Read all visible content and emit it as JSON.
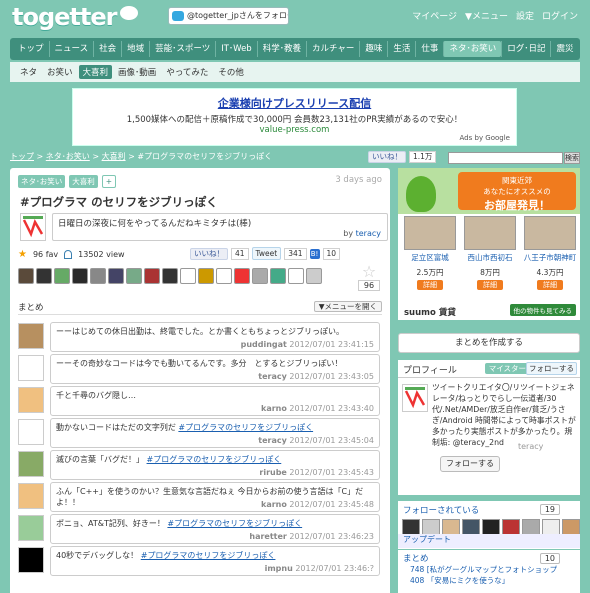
{
  "header": {
    "logo": "togetter",
    "follow_label": "@togetter_jpさんをフォロー",
    "links": [
      "マイページ",
      "▼メニュー",
      "設定",
      "ログイン"
    ]
  },
  "nav": [
    "トップ",
    "ニュース",
    "社会",
    "地域",
    "芸能･スポーツ",
    "IT･Web",
    "科学･教養",
    "カルチャー",
    "趣味",
    "生活",
    "仕事",
    "ネタ･お笑い",
    "ログ･日記",
    "震災"
  ],
  "nav_active_index": 11,
  "subnav": [
    "ネタ",
    "お笑い",
    "大喜利",
    "画像･動画",
    "やってみた",
    "その他"
  ],
  "subnav_active_index": 2,
  "ad": {
    "title": "企業様向けプレスリリース配信",
    "line": "1,500媒体への配信＋原稿作成で30,000円 会員数23,131社のPR実績があるので安心！",
    "url": "value-press.com",
    "by": "Ads by Google"
  },
  "breadcrumb": [
    "トップ",
    "ネタ･お笑い",
    "大喜利",
    "#プログラマのセリフをジブリっぽく"
  ],
  "like_top": {
    "label": "いいね！",
    "count": "1.1万"
  },
  "search_btn": "検索",
  "article": {
    "tags": [
      "ネタ･お笑い",
      "大喜利",
      "+"
    ],
    "ago": "3 days ago",
    "title": "#プログラマ のセリフをジブリっぽく",
    "desc": "日曜日の深夜に何をやってるんだねキミタチは(棒)",
    "by": "by",
    "author": "teracy",
    "fav": "96 fav",
    "views": "13502 view",
    "like": "いいね！",
    "like_count": "41",
    "tweet": "Tweet",
    "tweet_count": "341",
    "b_count": "10",
    "fav_total": "96",
    "matome": "まとめ",
    "menu_open": "▼メニューを開く"
  },
  "tweets": [
    {
      "text": "ーーはじめての休日出勤は、終電でした。とか書くともちょっとジブリっぽい。",
      "user": "puddingat",
      "time": "2012/07/01 23:41:15"
    },
    {
      "text": "ーーその奇妙なコードは今でも動いてるんです。多分　とするとジブリっぽい！",
      "user": "teracy",
      "time": "2012/07/01 23:43:05"
    },
    {
      "text": "千と千尋のバグ隠し…",
      "user": "karno",
      "time": "2012/07/01 23:43:40"
    },
    {
      "text": "動かないコードはただの文字列だ",
      "ht": "#プログラマのセリフをジブリっぽく",
      "user": "teracy",
      "time": "2012/07/01 23:45:04"
    },
    {
      "text": "滅びの言葉「バグだ！」",
      "ht": "#プログラマのセリフをジブリっぽく",
      "user": "rirube",
      "time": "2012/07/01 23:45:43"
    },
    {
      "text": "ふん「C++」を使うのかい？生意気な言語だねぇ 今日からお前の使う言語は「C」だよ！！",
      "user": "karno",
      "time": "2012/07/01 23:45:48"
    },
    {
      "text": "ポニョ、AT&T記列、好きー！",
      "ht": "#プログラマのセリフをジブリっぽく",
      "user": "haretter",
      "time": "2012/07/01 23:46:23"
    },
    {
      "text": "40秒でデバッグしな！",
      "ht": "#プログラマのセリフをジブリっぽく",
      "user": "impnu",
      "time": "2012/07/01 23:46:?"
    }
  ],
  "side": {
    "ad_head_small": "関東近郊",
    "ad_head_mid": "あなたにオススメの",
    "ad_head_big": "お部屋発見！",
    "houses": [
      {
        "name": "足立区富城",
        "price": "2.5万円"
      },
      {
        "name": "西山市西初石",
        "price": "8万円"
      },
      {
        "name": "八王子市朝神町",
        "price": "4.3万円"
      }
    ],
    "detail": "詳細",
    "suumo": "suumo 賃貸",
    "suumo_btn": "他の物件も見てみる",
    "create": "まとめを作成する",
    "profile_title": "プロフィール",
    "mytag": "マイスター",
    "follow_tw": "フォローする",
    "profile_desc": "ツイートクリエイタ〇/リツイートジェネレータ/ねっとりでらし一伝道者/30代/.Net/AMDer/放乏自作er/貧乏/うさぎ/Android 時間帯によって時事ポストが多かったり実態ポストが多かったり。規制垢: @teracy_2nd",
    "profile_user": "teracy",
    "follow_btn": "フォローする",
    "followers_label": "フォローされている",
    "followers_count": "19",
    "update_label": "アップデート",
    "matome_label": "まとめ",
    "matome_count": "10",
    "matome_items": [
      {
        "n": "748",
        "t": "[私がグーグルマップとフォトショップ"
      },
      {
        "n": "408",
        "t": "「安易にミクを使うな」"
      }
    ]
  }
}
